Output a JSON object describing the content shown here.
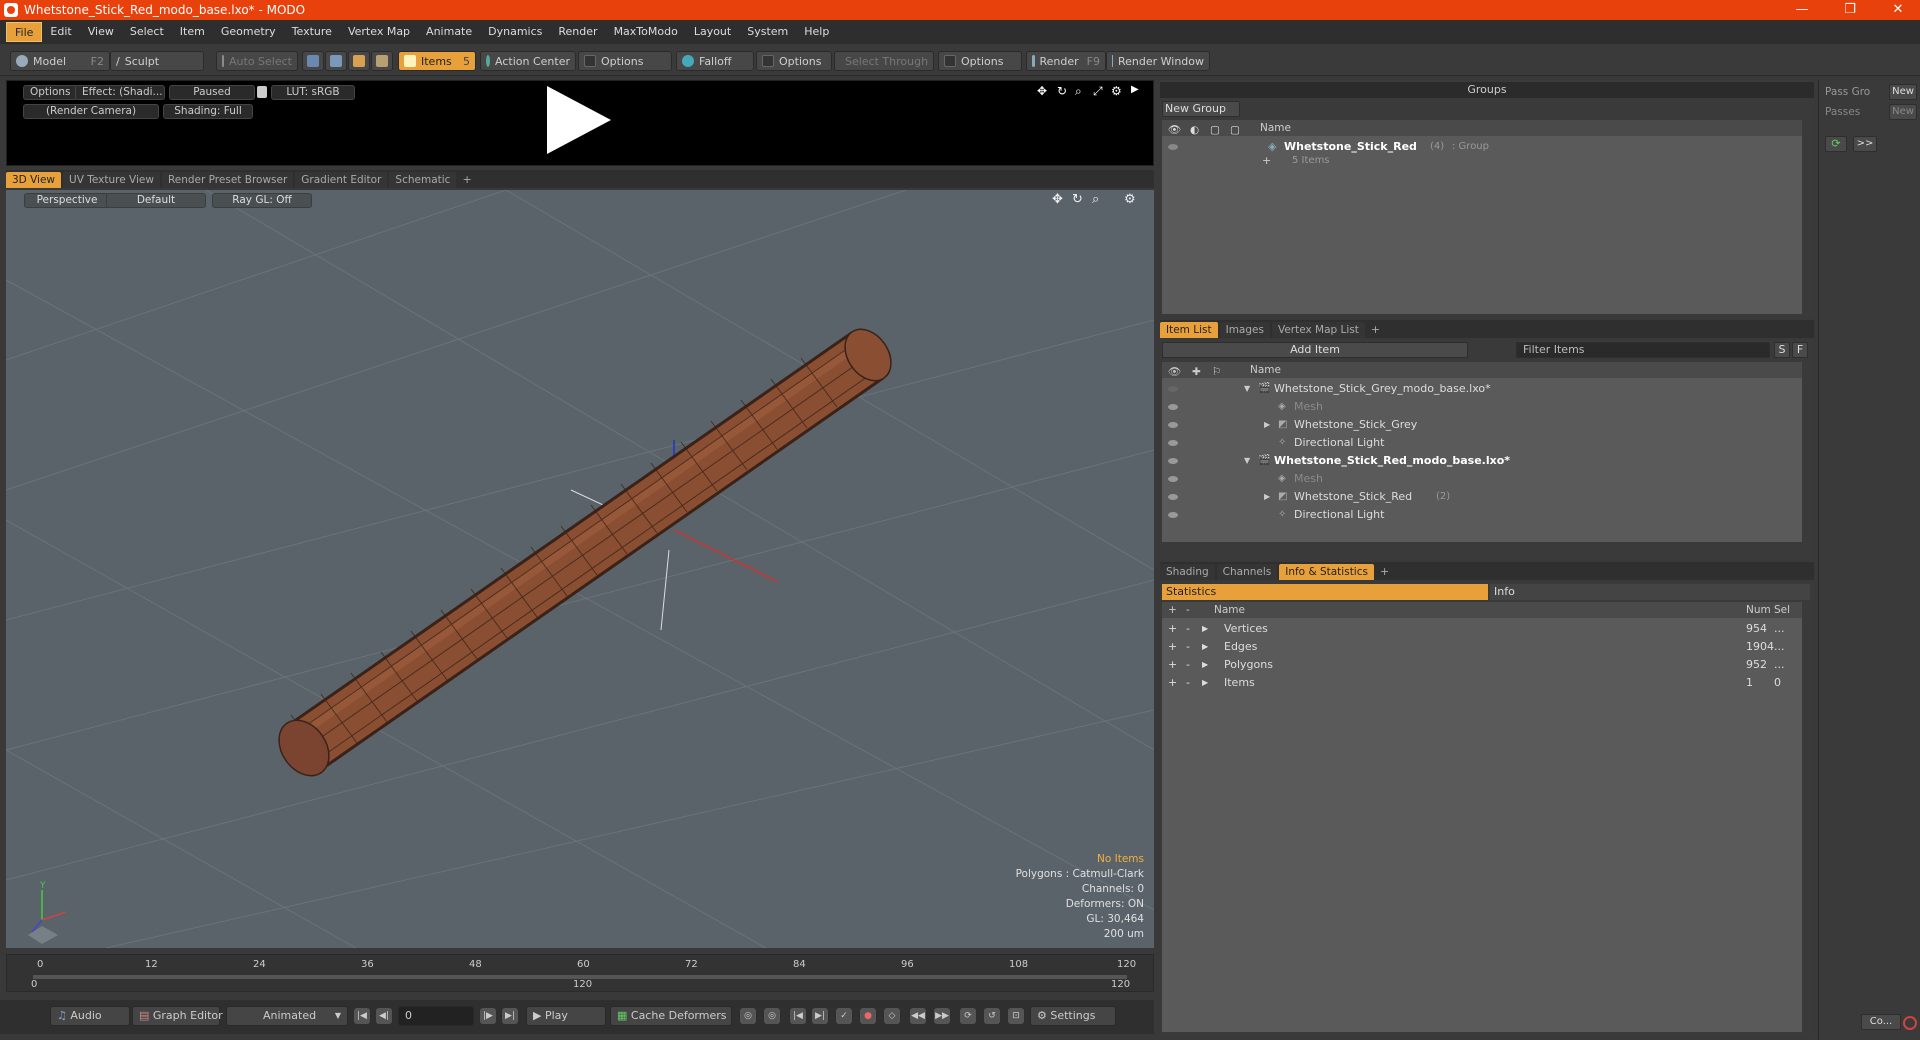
{
  "window": {
    "title": "Whetstone_Stick_Red_modo_base.lxo* - MODO",
    "minimize": "—",
    "maximize": "❐",
    "close": "✕"
  },
  "menu": [
    "File",
    "Edit",
    "View",
    "Select",
    "Item",
    "Geometry",
    "Texture",
    "Vertex Map",
    "Animate",
    "Dynamics",
    "Render",
    "MaxToModo",
    "Layout",
    "System",
    "Help"
  ],
  "toolbar": {
    "model": "Model",
    "model_key": "F2",
    "sculpt": "Sculpt",
    "auto_select": "Auto Select",
    "items": "Items",
    "items_key": "5",
    "action_center": "Action Center",
    "options1": "Options",
    "falloff": "Falloff",
    "options2": "Options",
    "select_through": "Select Through",
    "options3": "Options",
    "render": "Render",
    "render_key": "F9",
    "render_window": "Render Window"
  },
  "preview": {
    "options": "Options",
    "effect": "Effect: (Shadi...",
    "paused": "Paused",
    "lut": "LUT: sRGB",
    "camera": "(Render Camera)",
    "shading": "Shading: Full"
  },
  "viewport_tabs": [
    "3D View",
    "UV Texture View",
    "Render Preset Browser",
    "Gradient Editor",
    "Schematic"
  ],
  "viewport": {
    "perspective": "Perspective",
    "default": "Default",
    "raygl": "Ray GL: Off"
  },
  "viewport_stats": {
    "no_items": "No Items",
    "polygons": "Polygons : Catmull-Clark",
    "channels": "Channels: 0",
    "deformers": "Deformers: ON",
    "gl": "GL: 30,464",
    "units": "200 um"
  },
  "timeline": {
    "ticks": [
      "0",
      "12",
      "24",
      "36",
      "48",
      "60",
      "72",
      "84",
      "96",
      "108",
      "120"
    ],
    "start": "0",
    "mid": "120",
    "end": "120"
  },
  "bottom": {
    "audio": "Audio",
    "graph_editor": "Graph Editor",
    "animated": "Animated",
    "frame": "0",
    "play": "Play",
    "cache": "Cache Deformers",
    "settings": "Settings"
  },
  "groups": {
    "header": "Groups",
    "new_group": "New Group",
    "col_name": "Name",
    "group_name": "Whetstone_Stick_Red",
    "group_count": "(4)",
    "group_type": ": Group",
    "items": "5 Items"
  },
  "passes": {
    "pass_group": "Pass Gro",
    "new1": "New",
    "passes": "Passes",
    "new2": "New",
    "more": ">>",
    "co": "Co..."
  },
  "itemlist_tabs": [
    "Item List",
    "Images",
    "Vertex Map List"
  ],
  "itemlist": {
    "add_item": "Add Item",
    "filter": "Filter Items",
    "s": "S",
    "f": "F",
    "col_name": "Name",
    "rows": [
      {
        "label": "Whetstone_Stick_Grey_modo_base.lxo*",
        "extra": ""
      },
      {
        "label": "Mesh",
        "extra": ""
      },
      {
        "label": "Whetstone_Stick_Grey",
        "extra": ""
      },
      {
        "label": "Directional Light",
        "extra": ""
      },
      {
        "label": "Whetstone_Stick_Red_modo_base.lxo*",
        "extra": ""
      },
      {
        "label": "Mesh",
        "extra": ""
      },
      {
        "label": "Whetstone_Stick_Red",
        "extra": "(2)"
      },
      {
        "label": "Directional Light",
        "extra": ""
      }
    ]
  },
  "stats_tabs": [
    "Shading",
    "Channels",
    "Info & Statistics"
  ],
  "stats": {
    "statistics": "Statistics",
    "info": "Info",
    "col_name": "Name",
    "col_num": "Num",
    "col_sel": "Sel",
    "rows": [
      {
        "name": "Vertices",
        "num": "954",
        "sel": "..."
      },
      {
        "name": "Edges",
        "num": "1904",
        "sel": "..."
      },
      {
        "name": "Polygons",
        "num": "952",
        "sel": "..."
      },
      {
        "name": "Items",
        "num": "1",
        "sel": "0"
      }
    ]
  },
  "colors": {
    "accent": "#e8a13a",
    "titlebar": "#e8410c",
    "viewport_bg": "#5a6369",
    "stick": "#8a4e33"
  }
}
